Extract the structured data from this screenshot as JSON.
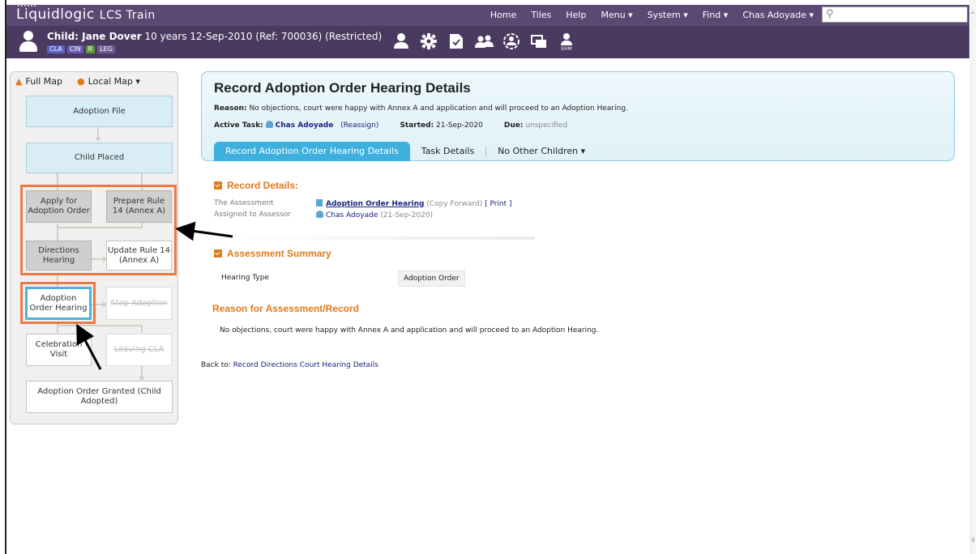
{
  "app": {
    "brand": "Liquidlogic",
    "name": "LCS Train"
  },
  "topnav": {
    "items": [
      "Home",
      "Tiles",
      "Help",
      "Menu ▾",
      "System ▾",
      "Find ▾",
      "Chas Adoyade ▾"
    ],
    "search_value": ""
  },
  "child": {
    "label": "Child: Jane Dover",
    "details": " 10 years 12-Sep-2010 (Ref: 700036) (Restricted)",
    "badges": [
      "CLA",
      "CIN",
      "R",
      "LEG"
    ],
    "toolbar_icons": [
      "person-icon",
      "gear-icon",
      "document-icon",
      "group-icon",
      "camera-icon",
      "screens-icon",
      "ehm-icon"
    ],
    "ehm_label": "EHM"
  },
  "map": {
    "full_map": "Full Map",
    "local_map": "Local Map ▾",
    "nodes": {
      "adoption_file": "Adoption File",
      "child_placed": "Child Placed",
      "apply_for_adoption_order": "Apply for Adoption Order",
      "prepare_rule_14": "Prepare Rule 14 (Annex A)",
      "directions_hearing": "Directions Hearing",
      "update_rule_14": "Update Rule 14 (Annex A)",
      "adoption_order_hearing": "Adoption Order Hearing",
      "stop_adoption": "Stop Adoption",
      "celebration_visit": "Celebration Visit",
      "leaving_cla": "Leaving CLA",
      "adoption_order_granted": "Adoption Order Granted (Child Adopted)"
    }
  },
  "header": {
    "title": "Record Adoption Order Hearing Details",
    "reason_label": "Reason:",
    "reason_text": " No objections, court were happy with Annex A and application and will proceed to an Adoption Hearing.",
    "active_task_label": "Active Task:",
    "active_task_user": "Chas Adoyade",
    "reassign": "(Reassign)",
    "started_label": "Started:",
    "started_value": " 21-Sep-2020",
    "due_label": "Due:",
    "due_value": " unspecified",
    "tabs": [
      "Record Adoption Order Hearing Details",
      "Task Details",
      "No Other Children ▾"
    ]
  },
  "record_details": {
    "heading": "Record Details:",
    "assessment_label": "The Assessment",
    "assessment_link": "Adoption Order Hearing",
    "copy_forward": " (Copy Forward) ",
    "print": "[ Print ]",
    "assigned_label": "Assigned to Assessor",
    "assessor_name": "Chas Adoyade",
    "assessor_date": " (21-Sep-2020)"
  },
  "assessment_summary": {
    "heading": "Assessment Summary",
    "hearing_type_label": "Hearing Type",
    "hearing_type_value": "Adoption Order"
  },
  "reason_section": {
    "heading": "Reason for Assessment/Record",
    "text": "No objections, court were happy with Annex A and application and will proceed to an Adoption Hearing."
  },
  "back_to": {
    "label": "Back to: ",
    "link": "Record Directions Court Hearing Details"
  },
  "colors": {
    "topbar": "#5b4873",
    "childbar": "#4a3a5f",
    "accent_orange": "#e07a1a",
    "tab_active": "#3eb0de",
    "highlight_box": "#ec7a45"
  }
}
